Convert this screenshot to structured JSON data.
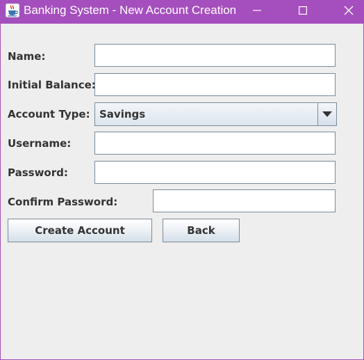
{
  "window": {
    "title": "Banking System - New Account Creation",
    "icons": {
      "app": "java-cup-icon",
      "minimize": "minimize-icon",
      "maximize": "maximize-icon",
      "close": "close-icon"
    },
    "colors": {
      "titlebar": "#a54fbe",
      "background": "#eeeeee"
    }
  },
  "form": {
    "name": {
      "label": "Name:",
      "value": ""
    },
    "initial_balance": {
      "label": "Initial Balance:",
      "value": ""
    },
    "account_type": {
      "label": "Account Type:",
      "selected": "Savings"
    },
    "username": {
      "label": "Username:",
      "value": ""
    },
    "password": {
      "label": "Password:",
      "value": ""
    },
    "confirm_password": {
      "label": "Confirm Password:",
      "value": ""
    }
  },
  "buttons": {
    "create_account": "Create Account",
    "back": "Back"
  }
}
